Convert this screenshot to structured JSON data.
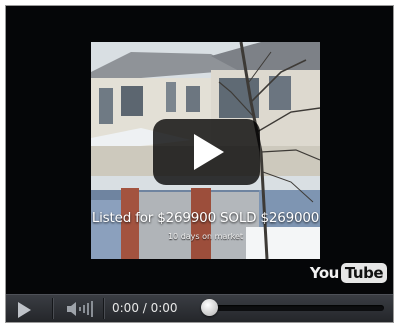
{
  "thumbnail": {
    "headline": "Listed for $269900 SOLD $269000",
    "subline": "10 days on market"
  },
  "overlay": {
    "play_icon": "play-icon"
  },
  "branding": {
    "you": "You",
    "tube": "Tube"
  },
  "controls": {
    "play_icon": "play-icon",
    "volume_icon": "volume-icon",
    "time": "0:00 / 0:00",
    "progress": 0
  },
  "colors": {
    "player_bg": "#000000",
    "controls_bg": "#2e3136",
    "text": "#e8e8e8"
  }
}
